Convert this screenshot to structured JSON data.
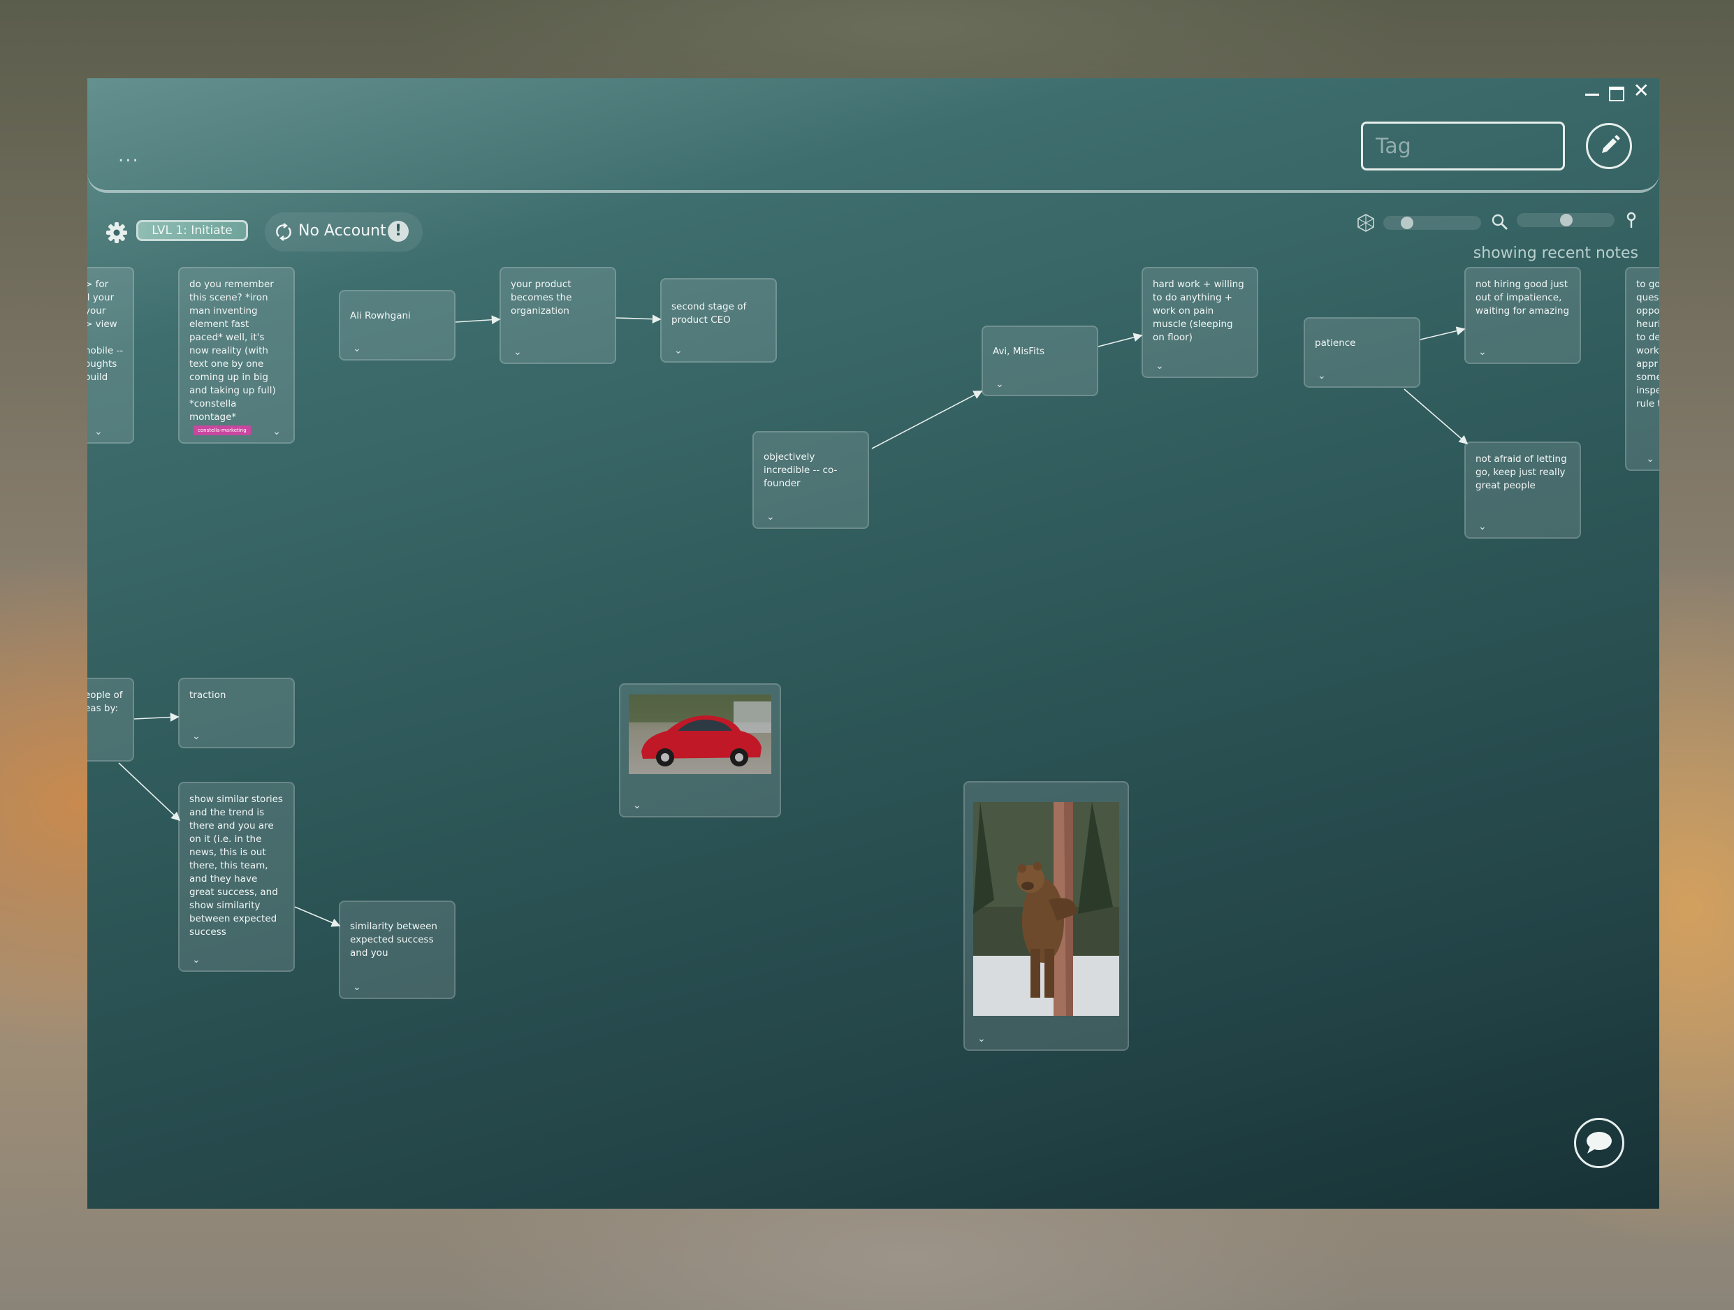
{
  "window": {
    "controls": {
      "minimize": "minimize-icon",
      "maximize": "maximize-icon",
      "close": "close-icon"
    }
  },
  "header": {
    "menu_label": "...",
    "tag_placeholder": "Tag",
    "edit_icon": "pencil-icon"
  },
  "toolbar": {
    "settings_icon": "gear-icon",
    "level_label": "LVL 1: Initiate",
    "account_label": "No Account",
    "warning_label": "!",
    "status_text": "showing recent notes"
  },
  "notes": {
    "n0": "> for\nll your\nyour\n> view\n\nnobile --\noughts\nbuild",
    "n1": "do you remember this scene? *iron man inventing element fast paced* well, it's now reality (with text one by one coming up in big and taking up full) *constella montage*",
    "n1_tag": "constella-marketing",
    "n2": "Ali Rowhgani",
    "n3": "your product becomes the organization",
    "n4": "second stage of product CEO",
    "n5": "objectively incredible -- co-founder",
    "n6": "Avi, MisFits",
    "n7": "hard work + willing to do anything + work on pain muscle (sleeping on floor)",
    "n8": "patience",
    "n9": "not hiring good just out of impatience, waiting for amazing",
    "n10": "not afraid of letting go, keep just really great people",
    "n11": "to go\nques\noppo\nheuri\nto de\nwork\nappr\nsome\ninspe\nrule t",
    "n12": "eople of\neas by:",
    "n13": "traction",
    "n14": "show similar stories and the trend is there and you are on it (i.e. in the news, this is out there, this team, and they have great success, and show similarity between expected success",
    "n15": "similarity between expected success and you"
  },
  "images": {
    "car": "red-car-image",
    "bear": "bear-on-tree-image"
  },
  "chat": {
    "icon": "chat-bubble-icon"
  },
  "colors": {
    "window_top": "#64918f",
    "window_bottom": "#173236",
    "card_tag": "#c9479f",
    "level_badge": "#8fbdb3"
  }
}
